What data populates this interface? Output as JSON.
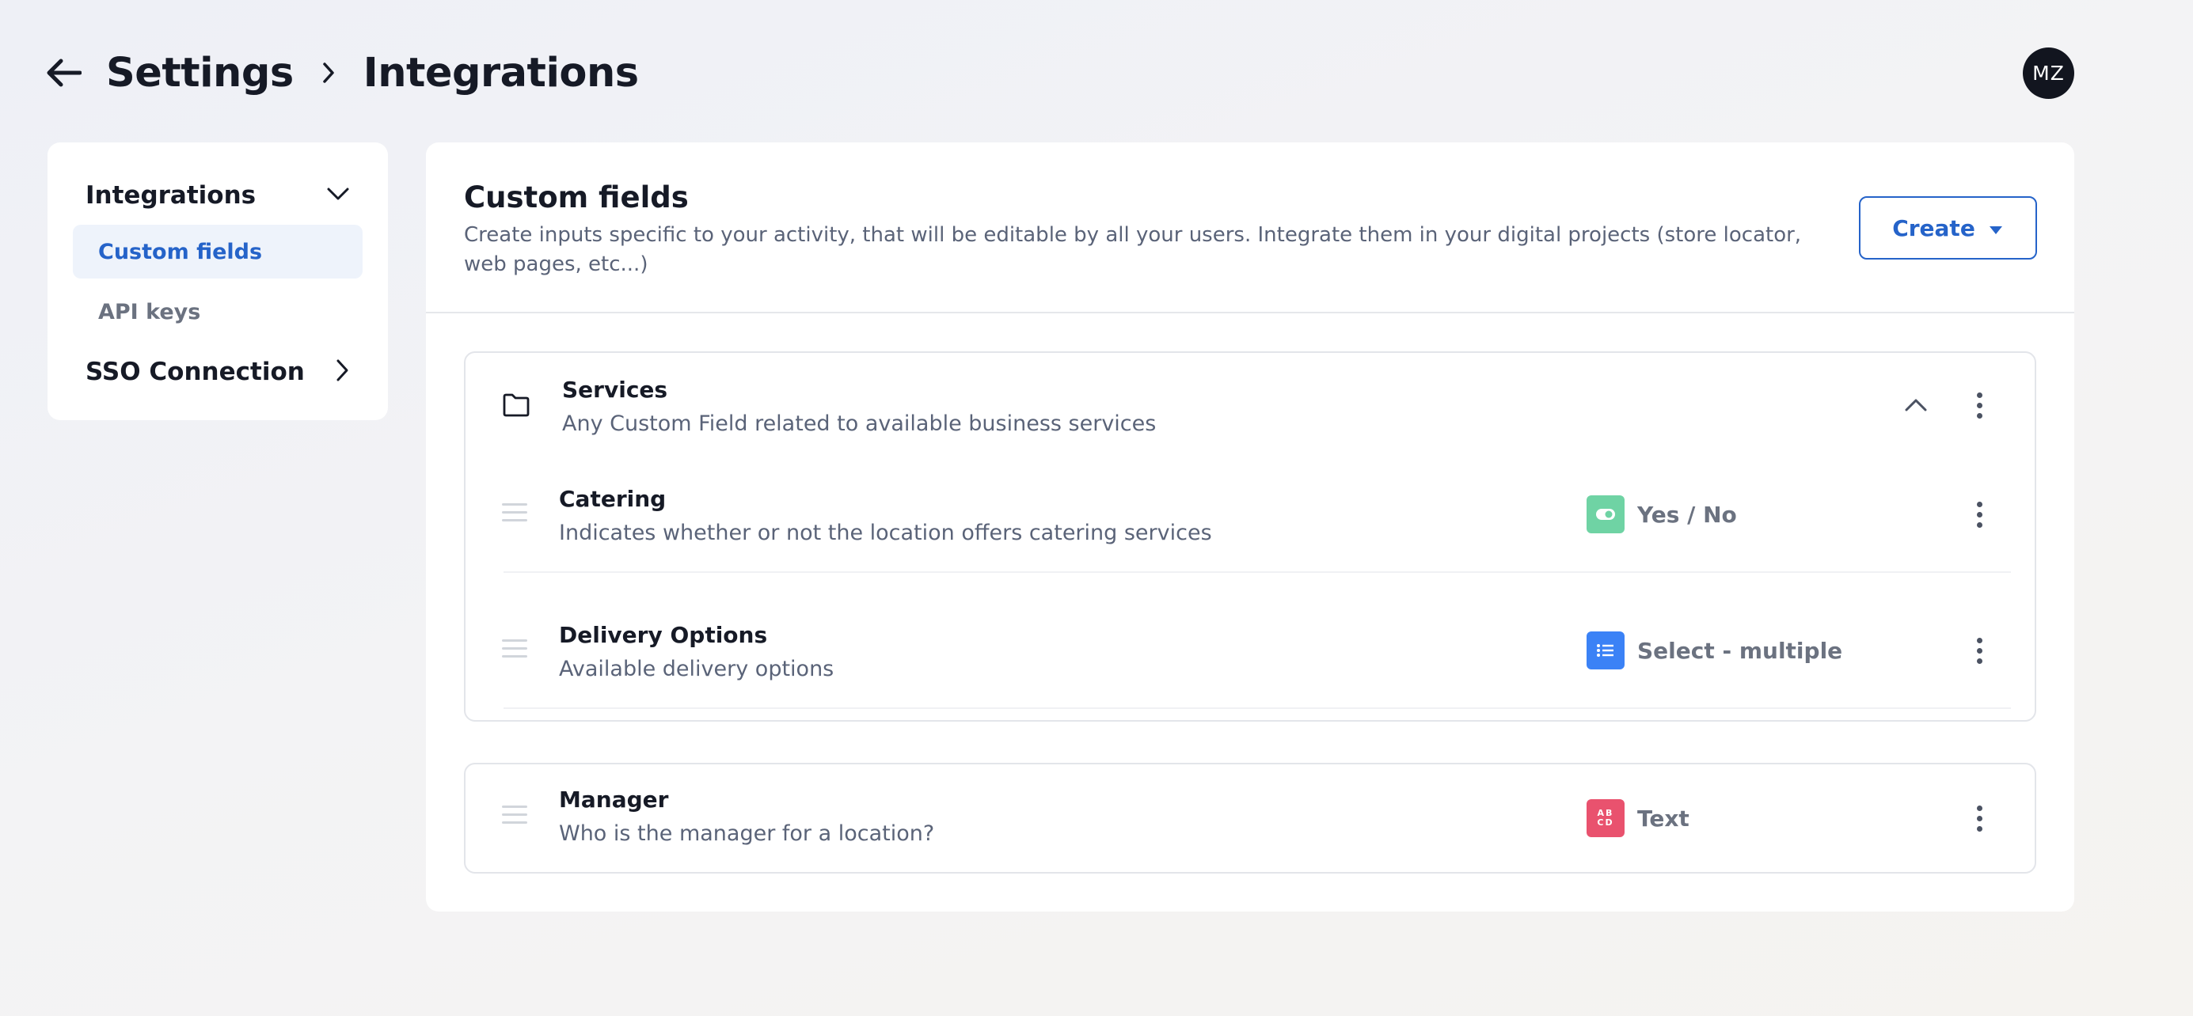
{
  "header": {
    "breadcrumb": [
      "Settings",
      "Integrations"
    ],
    "avatar_initials": "MZ"
  },
  "sidebar": {
    "groups": [
      {
        "label": "Integrations",
        "expanded": true,
        "icon": "chevron-down-icon",
        "items": [
          {
            "label": "Custom fields",
            "active": true
          },
          {
            "label": "API keys",
            "active": false
          }
        ]
      },
      {
        "label": "SSO Connection",
        "expanded": false,
        "icon": "chevron-right-icon"
      }
    ]
  },
  "main": {
    "title": "Custom fields",
    "description": "Create inputs specific to your activity, that will be editable by all your users. Integrate them in your digital projects (store locator, web pages, etc...)",
    "create_label": "Create",
    "groups": [
      {
        "title": "Services",
        "description": "Any Custom Field related to available business services",
        "icon": "folder-icon",
        "expanded": true,
        "fields": [
          {
            "title": "Catering",
            "description": "Indicates whether or not the location offers catering services",
            "type": "Yes / No",
            "type_icon": "toggle-icon",
            "type_color": "#6fd3a4"
          },
          {
            "title": "Delivery Options",
            "description": "Available delivery options",
            "type": "Select - multiple",
            "type_icon": "list-icon",
            "type_color": "#3b82f6"
          }
        ]
      }
    ],
    "standalone_fields": [
      {
        "title": "Manager",
        "description": "Who is the manager for a location?",
        "type": "Text",
        "type_icon": "abcd-icon",
        "type_icon_text": "AB CD",
        "type_color": "#e9526e"
      }
    ]
  },
  "colors": {
    "accent": "#2563c9",
    "active_bg": "#eef3fb",
    "toggle_badge": "#6fd3a4",
    "select_badge": "#3b82f6",
    "text_badge": "#e9526e"
  }
}
